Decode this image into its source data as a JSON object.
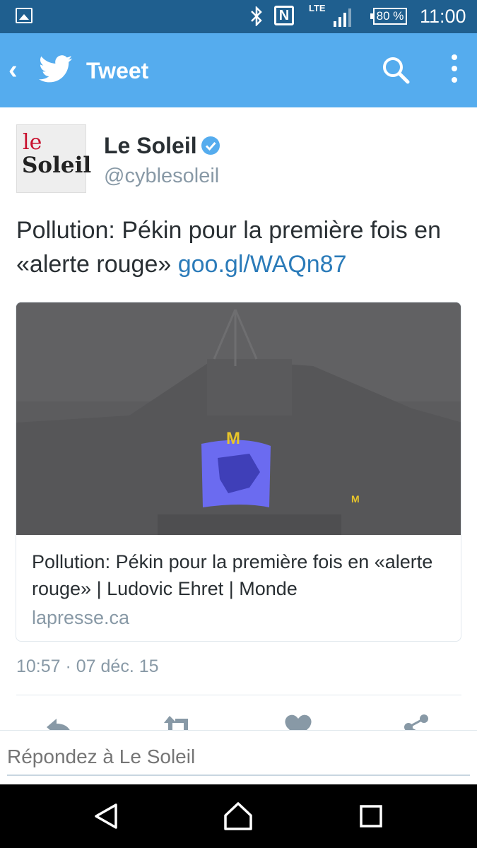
{
  "status_bar": {
    "network": "LTE",
    "battery": "80 %",
    "time": "11:00"
  },
  "app_bar": {
    "title": "Tweet"
  },
  "tweet": {
    "author_name": "Le Soleil",
    "handle": "@cyblesoleil",
    "avatar_line1": "le",
    "avatar_line2": "Soleil",
    "text": "Pollution: Pékin pour la première fois en «alerte rouge» ",
    "link": "goo.gl/WAQn87",
    "timestamp": "10:57 · 07 déc. 15"
  },
  "card": {
    "title": "Pollution: Pékin pour la première fois en «alerte rouge» | Ludovic Ehret | Monde",
    "domain": "lapresse.ca"
  },
  "reply": {
    "placeholder": "Répondez à Le Soleil"
  },
  "colors": {
    "twitter_blue": "#55acee",
    "status_bar": "#1f5f8f",
    "link": "#2b7bb9",
    "muted": "#8899a6"
  },
  "icons": [
    "image-icon",
    "bluetooth-icon",
    "nfc-icon",
    "signal-icon",
    "battery-icon",
    "back-icon",
    "twitter-bird-icon",
    "search-icon",
    "more-icon",
    "verified-icon",
    "reply-icon",
    "retweet-icon",
    "like-icon",
    "share-icon",
    "nav-back-icon",
    "nav-home-icon",
    "nav-recents-icon"
  ]
}
